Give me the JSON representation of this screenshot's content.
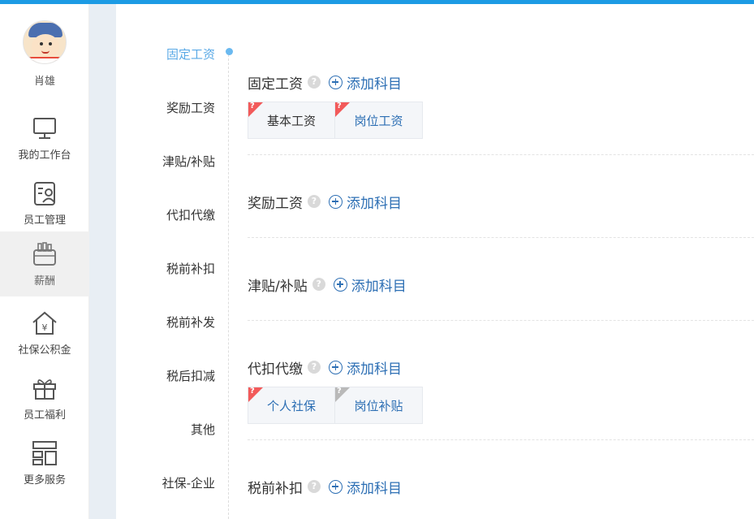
{
  "user": {
    "name": "肖雄"
  },
  "nav": [
    {
      "label": "我的工作台",
      "icon": "monitor-icon"
    },
    {
      "label": "员工管理",
      "icon": "employee-card-icon"
    },
    {
      "label": "薪酬",
      "icon": "wallet-icon"
    },
    {
      "label": "社保公积金",
      "icon": "house-yen-icon"
    },
    {
      "label": "员工福利",
      "icon": "gift-icon"
    },
    {
      "label": "更多服务",
      "icon": "grid-icon"
    }
  ],
  "subnav": [
    {
      "label": "固定工资"
    },
    {
      "label": "奖励工资"
    },
    {
      "label": "津贴/补贴"
    },
    {
      "label": "代扣代缴"
    },
    {
      "label": "税前补扣"
    },
    {
      "label": "税前补发"
    },
    {
      "label": "税后扣减"
    },
    {
      "label": "其他"
    },
    {
      "label": "社保-企业"
    }
  ],
  "add_label": "添加科目",
  "help_glyph": "?",
  "sections": [
    {
      "title": "固定工资",
      "items": [
        {
          "label": "基本工资"
        },
        {
          "label": "岗位工资"
        }
      ]
    },
    {
      "title": "奖励工资",
      "items": []
    },
    {
      "title": "津贴/补贴",
      "items": []
    },
    {
      "title": "代扣代缴",
      "items": [
        {
          "label": "个人社保"
        },
        {
          "label": "岗位补贴"
        }
      ]
    },
    {
      "title": "税前补扣",
      "items": []
    }
  ],
  "colors": {
    "accent": "#1c9be4",
    "link": "#2d6fb4",
    "active_subnav": "#5aa9e6",
    "tag_red": "#f25a5a",
    "tag_grey": "#b9b9b9"
  }
}
